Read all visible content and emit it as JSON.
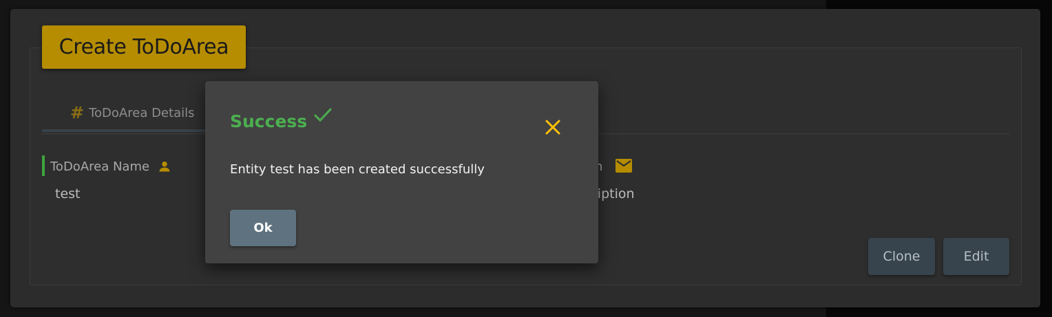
{
  "colors": {
    "accent": "#b68d00",
    "success": "#4caf50",
    "close": "#ffc107",
    "button": "#37444d",
    "ok_button": "#5f727f"
  },
  "header": {
    "title": "Create ToDoArea"
  },
  "tabs": [
    {
      "label": "ToDoArea Details",
      "icon": "hash-icon"
    }
  ],
  "fields": [
    {
      "label": "ToDoArea Name",
      "icon": "person-icon",
      "value": "test"
    },
    {
      "label": "n",
      "icon": "mail-icon",
      "value": "ription"
    }
  ],
  "actions": {
    "clone_label": "Clone",
    "edit_label": "Edit"
  },
  "modal": {
    "title": "Success",
    "message": "Entity test has been created successfully",
    "ok_label": "Ok"
  }
}
